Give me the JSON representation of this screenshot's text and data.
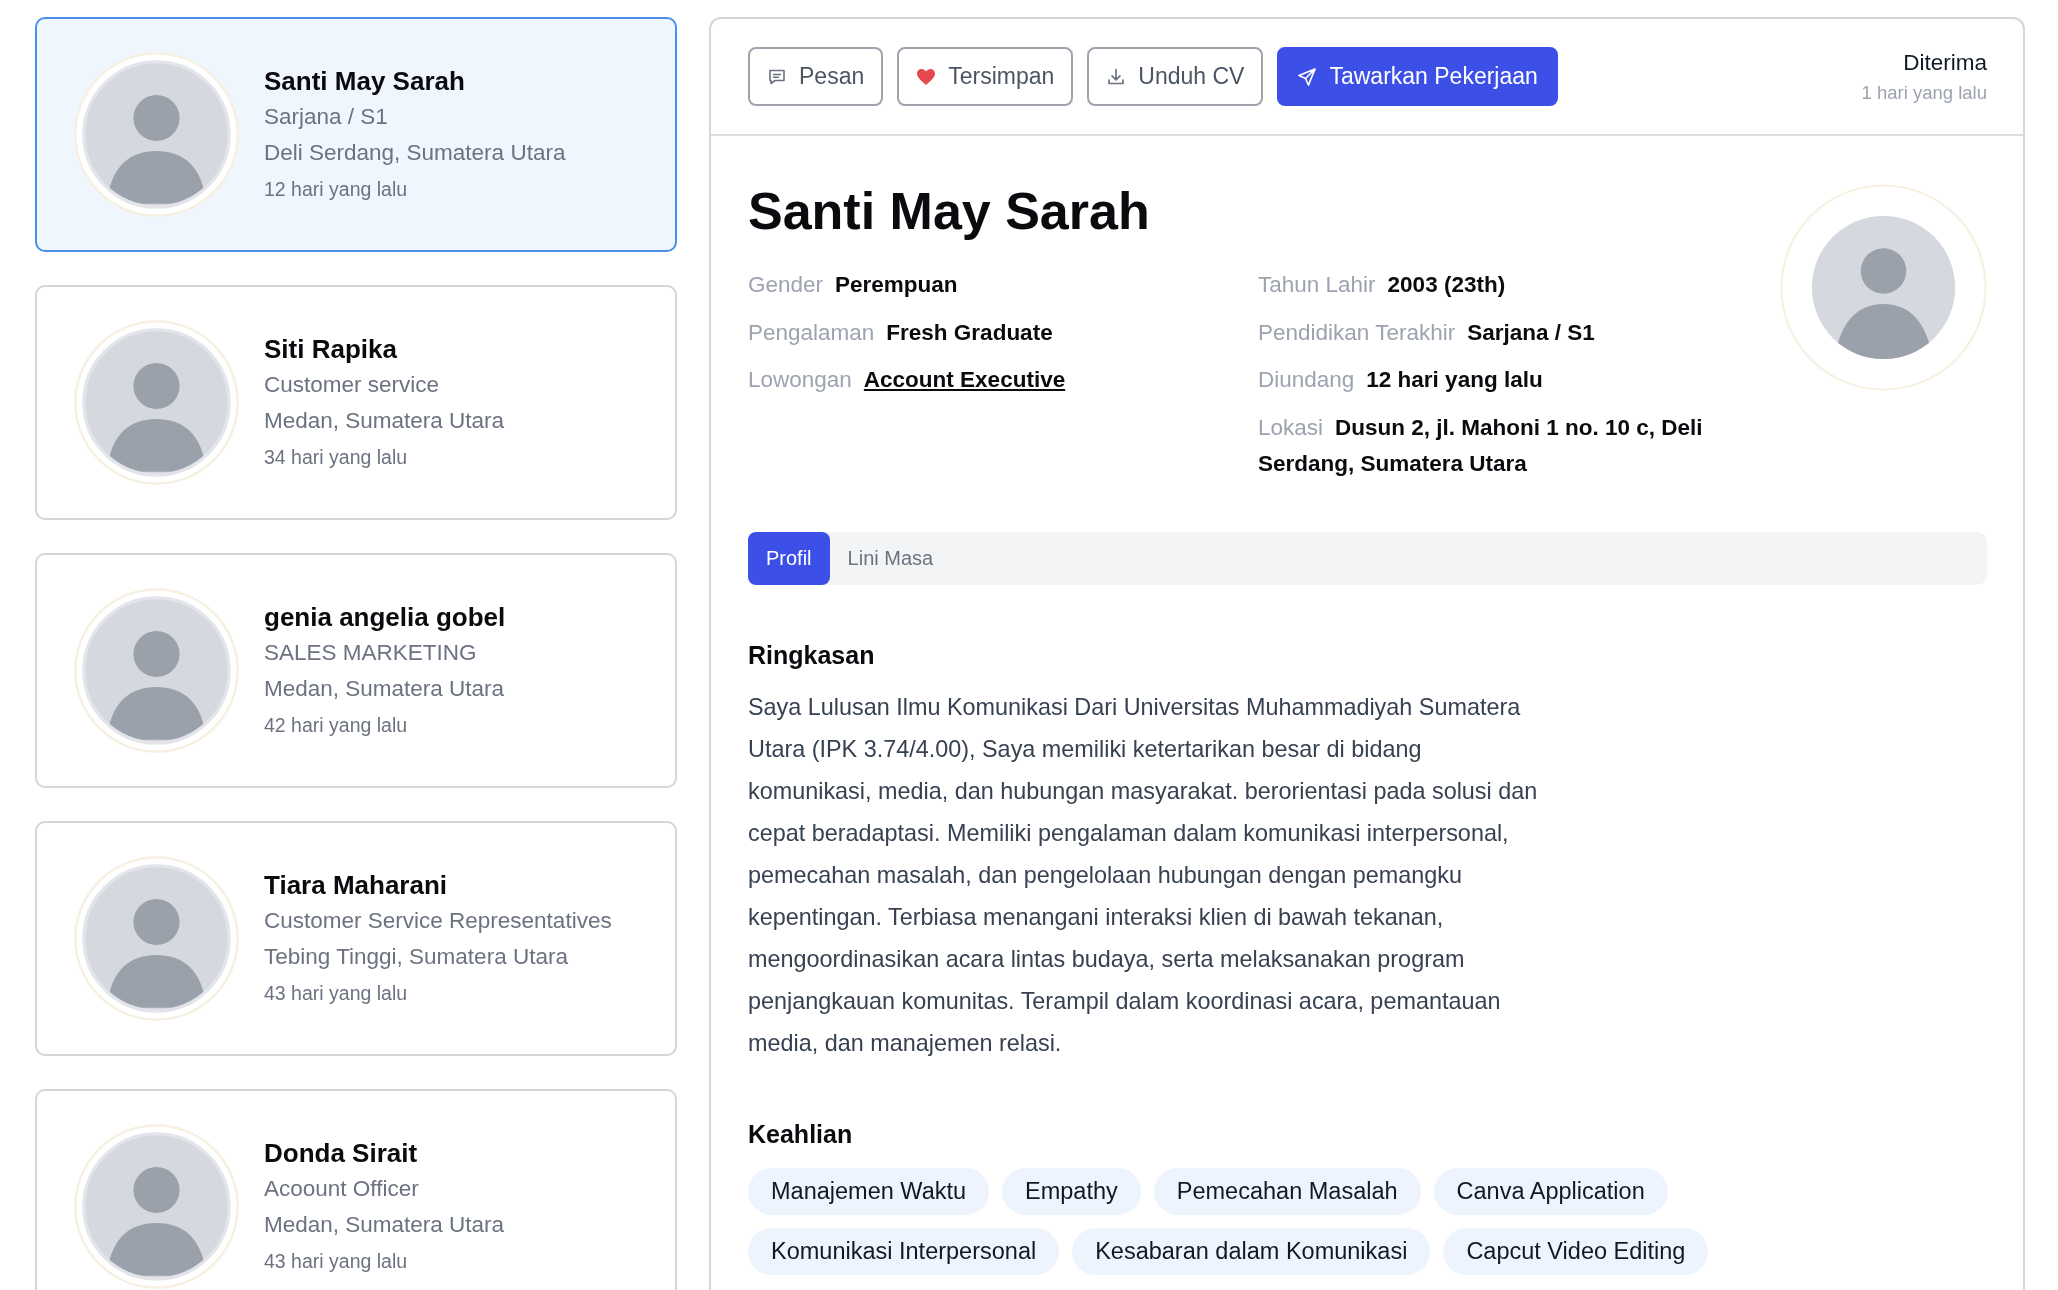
{
  "candidates": [
    {
      "name": "Santi May Sarah",
      "subtitle": "Sarjana / S1",
      "location": "Deli Serdang, Sumatera Utara",
      "time": "12 hari yang lalu",
      "selected": true
    },
    {
      "name": "Siti Rapika",
      "subtitle": "Customer service",
      "location": "Medan, Sumatera Utara",
      "time": "34 hari yang lalu",
      "selected": false
    },
    {
      "name": "genia angelia gobel",
      "subtitle": "SALES MARKETING",
      "location": "Medan, Sumatera Utara",
      "time": "42 hari yang lalu",
      "selected": false
    },
    {
      "name": "Tiara Maharani",
      "subtitle": "Customer Service Representatives",
      "location": "Tebing Tinggi, Sumatera Utara",
      "time": "43 hari yang lalu",
      "selected": false
    },
    {
      "name": "Donda Sirait",
      "subtitle": "Acoount Officer",
      "location": "Medan, Sumatera Utara",
      "time": "43 hari yang lalu",
      "selected": false
    }
  ],
  "toolbar": {
    "buttons": [
      {
        "kind": "message",
        "label": "Pesan"
      },
      {
        "kind": "saved",
        "label": "Tersimpan"
      },
      {
        "kind": "download",
        "label": "Unduh CV"
      },
      {
        "kind": "offer",
        "label": "Tawarkan Pekerjaan"
      }
    ],
    "status": {
      "label": "Diterima",
      "time": "1 hari yang lalu"
    }
  },
  "profile": {
    "name": "Santi May Sarah",
    "details": {
      "column_1": [
        {
          "kind": "text",
          "label": "Gender",
          "value": "Perempuan"
        },
        {
          "kind": "text",
          "label": "Pengalaman",
          "value": "Fresh Graduate"
        },
        {
          "kind": "link",
          "label": "Lowongan",
          "value": "Account Executive"
        }
      ],
      "column_2": [
        {
          "kind": "text",
          "label": "Tahun Lahir",
          "value": "2003 (23th)"
        },
        {
          "kind": "text",
          "label": "Pendidikan Terakhir",
          "value": "Sarjana / S1"
        },
        {
          "kind": "text",
          "label": "Diundang",
          "value": "12 hari yang lalu"
        },
        {
          "kind": "text",
          "label": "Lokasi",
          "value": "Dusun 2, jl. Mahoni 1 no. 10 c, Deli Serdang, Sumatera Utara"
        }
      ]
    },
    "tabs": [
      {
        "label": "Profil",
        "selected": true
      },
      {
        "label": "Lini Masa",
        "selected": false
      }
    ],
    "sections": [
      {
        "kind": "summary",
        "title": "Ringkasan",
        "text": "Saya Lulusan Ilmu Komunikasi Dari Universitas Muhammadiyah Sumatera Utara (IPK 3.74/4.00), Saya memiliki ketertarikan besar di bidang komunikasi, media, dan hubungan masyarakat. berorientasi pada solusi dan cepat beradaptasi. Memiliki pengalaman dalam komunikasi interpersonal, pemecahan masalah, dan pengelolaan hubungan dengan pemangku kepentingan. Terbiasa menangani interaksi klien di bawah tekanan, mengoordinasikan acara lintas budaya, serta melaksanakan program penjangkauan komunitas. Terampil dalam koordinasi acara, pemantauan media, dan manajemen relasi."
      },
      {
        "kind": "skills",
        "title": "Keahlian",
        "items": [
          "Manajemen Waktu",
          "Empathy",
          "Pemecahan Masalah",
          "Canva Application",
          "Komunikasi Interpersonal",
          "Kesabaran dalam Komunikasi",
          "Capcut Video Editing"
        ]
      }
    ]
  }
}
